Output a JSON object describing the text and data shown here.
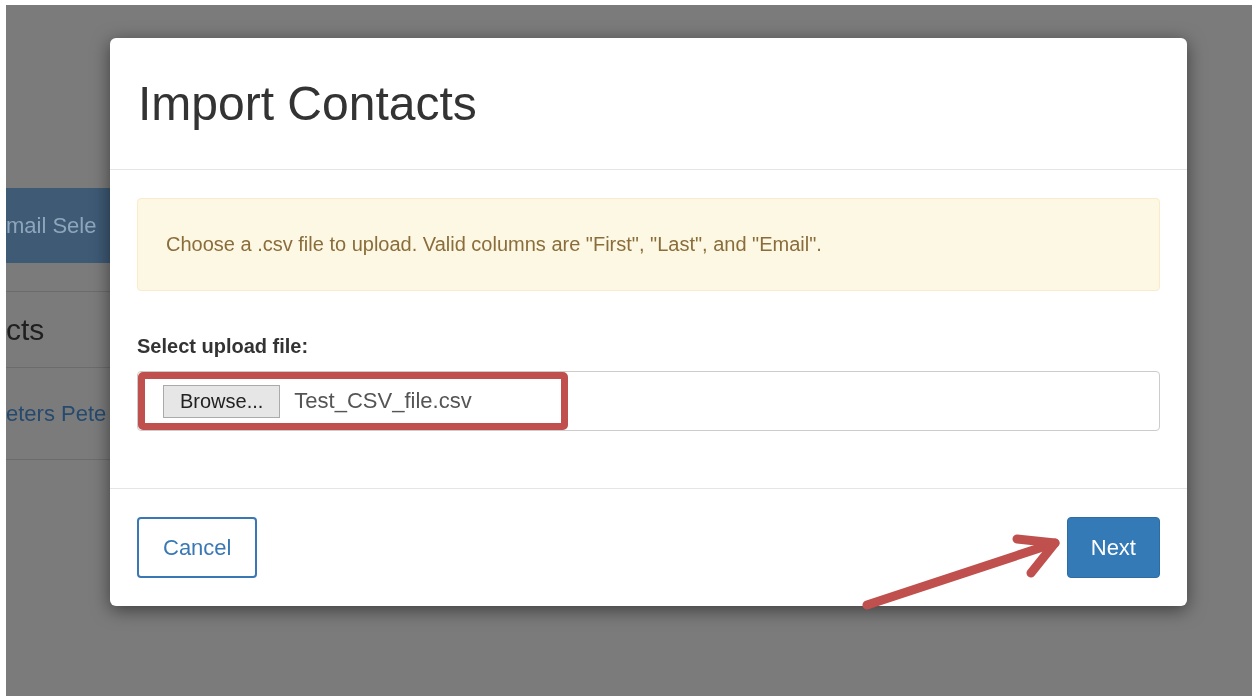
{
  "background_page": {
    "button_label": "mail Sele",
    "heading": "cts",
    "contact_link": "eters Pete"
  },
  "modal": {
    "title": "Import Contacts",
    "alert": "Choose a .csv file to upload. Valid columns are \"First\", \"Last\", and \"Email\".",
    "file_field": {
      "label": "Select upload file:",
      "browse_label": "Browse...",
      "value": "Test_CSV_file.csv",
      "highlighted": true
    },
    "buttons": [
      {
        "label": "Cancel",
        "kind": "secondary"
      },
      {
        "label": "Next",
        "kind": "primary",
        "annotated": true
      }
    ]
  }
}
